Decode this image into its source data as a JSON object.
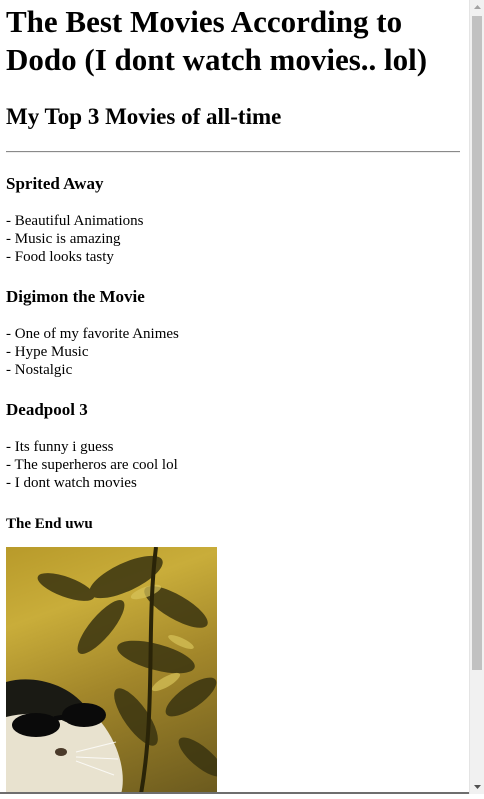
{
  "title": "The Best Movies According to Dodo (I dont watch movies.. lol)",
  "subtitle": "My Top 3 Movies of all-time",
  "movies": [
    {
      "name": "Sprited Away",
      "points": [
        "- Beautiful Animations",
        "- Music is amazing",
        "- Food looks tasty"
      ]
    },
    {
      "name": "Digimon the Movie",
      "points": [
        "- One of my favorite Animes",
        "- Hype Music",
        "- Nostalgic"
      ]
    },
    {
      "name": "Deadpool 3",
      "points": [
        "- Its funny i guess",
        "- The superheros are cool lol",
        "- I dont watch movies"
      ]
    }
  ],
  "footer": "The End uwu",
  "image": {
    "subject": "cat-with-sunglasses-gif"
  },
  "colors": {
    "background": "#ffffff",
    "text": "#000000",
    "scrollbar_thumb": "#c1c1c1"
  }
}
